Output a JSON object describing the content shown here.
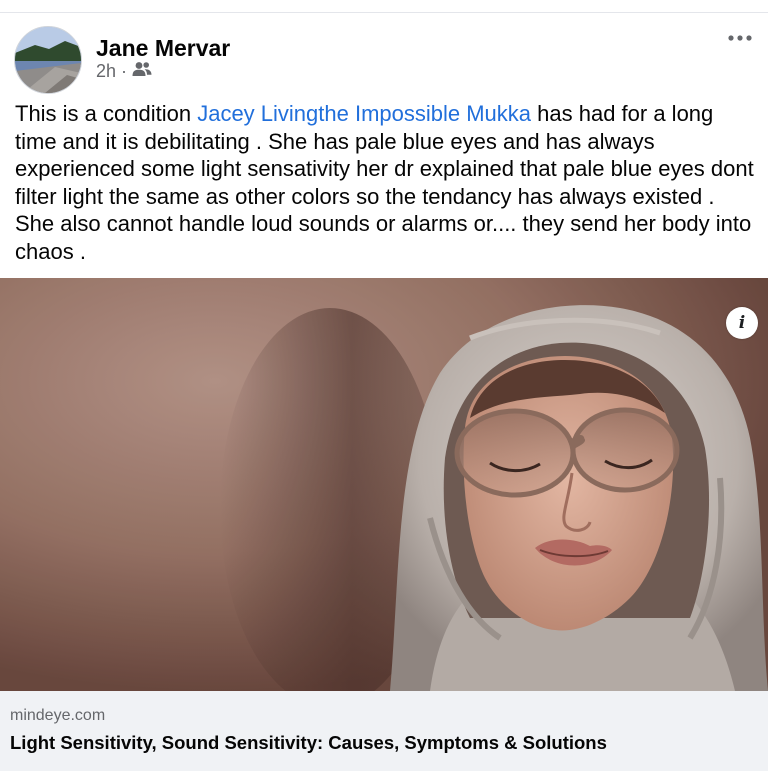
{
  "post": {
    "author": "Jane Mervar",
    "time": "2h",
    "separator": "·",
    "audience_icon": "friends-icon",
    "more_icon": "more-options-icon",
    "text_before": "This is a condition ",
    "mention": "Jacey Livingthe Impossible Mukka",
    "text_after": " has had for a long time and it is debilitating . She has pale blue eyes and has always experienced some light sensativity her dr explained that pale blue eyes dont filter light the same as other colors so the tendancy has always existed . She also cannot handle loud sounds or alarms or.... they send her body into chaos ."
  },
  "media": {
    "info_icon": "info-icon",
    "info_glyph": "i"
  },
  "link_preview": {
    "domain": "mindeye.com",
    "title": "Light Sensitivity, Sound Sensitivity: Causes, Symptoms & Solutions"
  },
  "colors": {
    "mention": "#216fdb",
    "secondary_text": "#65676b",
    "link_card_bg": "#f0f2f5"
  }
}
